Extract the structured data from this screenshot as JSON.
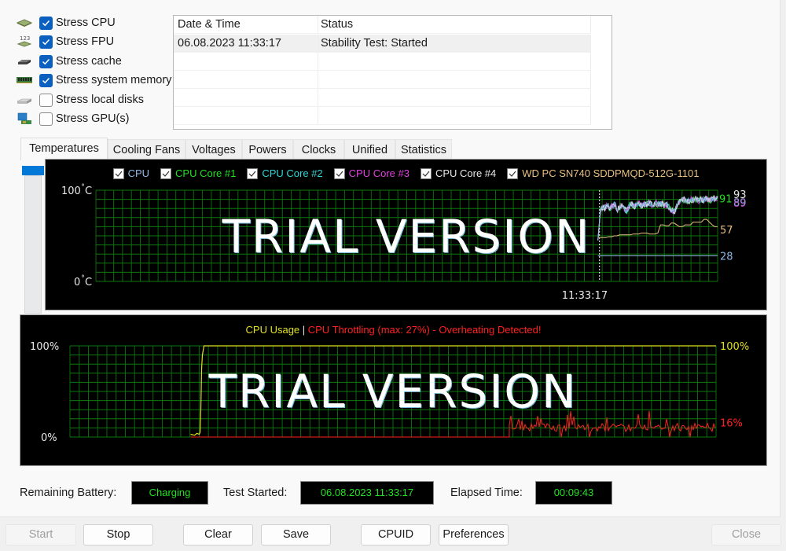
{
  "stress_options": [
    {
      "label": "Stress CPU",
      "checked": true,
      "icon": "cpu-chip-icon"
    },
    {
      "label": "Stress FPU",
      "checked": true,
      "icon": "fpu-chip-icon"
    },
    {
      "label": "Stress cache",
      "checked": true,
      "icon": "cache-chip-icon"
    },
    {
      "label": "Stress system memory",
      "checked": true,
      "icon": "memory-module-icon"
    },
    {
      "label": "Stress local disks",
      "checked": false,
      "icon": "disk-drive-icon"
    },
    {
      "label": "Stress GPU(s)",
      "checked": false,
      "icon": "gpu-card-icon"
    }
  ],
  "log": {
    "columns": [
      "Date & Time",
      "Status"
    ],
    "rows": [
      {
        "datetime": "06.08.2023 11:33:17",
        "status": "Stability Test: Started"
      }
    ]
  },
  "tabs": [
    {
      "label": "Temperatures",
      "active": true
    },
    {
      "label": "Cooling Fans",
      "active": false
    },
    {
      "label": "Voltages",
      "active": false
    },
    {
      "label": "Powers",
      "active": false
    },
    {
      "label": "Clocks",
      "active": false
    },
    {
      "label": "Unified",
      "active": false
    },
    {
      "label": "Statistics",
      "active": false
    }
  ],
  "watermark": "TRIAL VERSION",
  "chart_data": [
    {
      "type": "line",
      "title": "Temperatures",
      "ylabel": "°C",
      "ylim": [
        0,
        100
      ],
      "y_top_label": "100",
      "y_bottom_label": "0",
      "unit": "C",
      "x_marker_label": "11:33:17",
      "grid": true,
      "legend_placement": "top-center",
      "series": [
        {
          "name": "CPU",
          "color": "#8fb8e8",
          "checked": true,
          "current": 89
        },
        {
          "name": "CPU Core #1",
          "color": "#22e022",
          "checked": true,
          "current": 91
        },
        {
          "name": "CPU Core #2",
          "color": "#33d6d6",
          "checked": true,
          "current": 93
        },
        {
          "name": "CPU Core #3",
          "color": "#e040e0",
          "checked": true,
          "current": 89
        },
        {
          "name": "CPU Core #4",
          "color": "#e8e8e8",
          "checked": true,
          "current": 93
        },
        {
          "name": "WD PC SN740 SDDPMQD-512G-1101",
          "color": "#e8c080",
          "checked": true,
          "current": 57
        }
      ],
      "current_labels": [
        {
          "text": "91",
          "color": "#22e022"
        },
        {
          "text": "93",
          "color": "#e8e8e8"
        },
        {
          "text": "89",
          "color": "#8fb8e8"
        },
        {
          "text": "57",
          "color": "#e8c080"
        },
        {
          "text": "28",
          "color": "#8fb8e8"
        }
      ],
      "core_trace": [
        45,
        77,
        82,
        80,
        84,
        79,
        83,
        85,
        78,
        82,
        84,
        80,
        77,
        83,
        85,
        82,
        84,
        86,
        83,
        85,
        84,
        86,
        85,
        83,
        87,
        84,
        86,
        85,
        83,
        84,
        80,
        78,
        76,
        84,
        87,
        88,
        90,
        89,
        88,
        90,
        89,
        91,
        88,
        90,
        89,
        91,
        90,
        89,
        91,
        90,
        91
      ],
      "ssd_trace": [
        48,
        48,
        48,
        48,
        49,
        49,
        50,
        50,
        51,
        51,
        51,
        51,
        51,
        52,
        52,
        52,
        53,
        53,
        53,
        52,
        52,
        52,
        53,
        62,
        62,
        61,
        61,
        64,
        64,
        62,
        60,
        60,
        62,
        62,
        62,
        65,
        65,
        65,
        65,
        68,
        68,
        65,
        62,
        60,
        60
      ],
      "ssd_x_start_fraction": 0.81,
      "cpu_package_baseline": 28
    },
    {
      "type": "line",
      "title": "CPU Usage | CPU Throttling",
      "ylim": [
        0,
        100
      ],
      "y_top_label": "100%",
      "y_bottom_label": "0%",
      "grid": true,
      "title_parts": [
        {
          "text": "CPU Usage",
          "color": "#e0e020"
        },
        {
          "text": " | ",
          "color": "#e8e8e8"
        },
        {
          "text": "CPU Throttling (max: 27%) - Overheating Detected!",
          "color": "#ff2020"
        }
      ],
      "series": [
        {
          "name": "CPU Usage",
          "color": "#e0e020",
          "current": 100,
          "current_label": "100%"
        },
        {
          "name": "CPU Throttling",
          "color": "#ff2020",
          "current": 16,
          "current_label": "16%",
          "max": 27
        }
      ],
      "usage_ramp_fraction": 0.205,
      "throttle_start_fraction": 0.68
    }
  ],
  "status": {
    "battery_label": "Remaining Battery:",
    "battery_value": "Charging",
    "started_label": "Test Started:",
    "started_value": "06.08.2023 11:33:17",
    "elapsed_label": "Elapsed Time:",
    "elapsed_value": "00:09:43"
  },
  "buttons": {
    "start": "Start",
    "stop": "Stop",
    "clear": "Clear",
    "save": "Save",
    "cpuid": "CPUID",
    "preferences": "Preferences",
    "close": "Close"
  }
}
